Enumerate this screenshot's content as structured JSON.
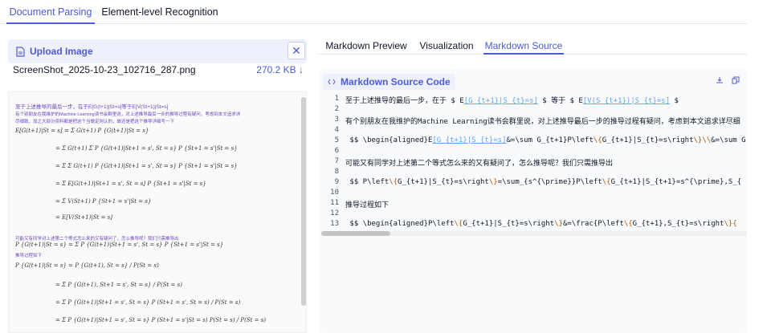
{
  "top_tabs": [
    {
      "label": "Document Parsing",
      "active": true
    },
    {
      "label": "Element-level Recognition",
      "active": false
    }
  ],
  "upload": {
    "label": "Upload Image",
    "icon": "document-icon",
    "file_name": "ScreenShot_2025-10-23_102716_287.png",
    "file_size": "270.2 KB ↓"
  },
  "preview_lines": {
    "l1": "至于上述推导的最后一步，在于E[G(t+1)|St=s]等于E[V(St+1)|St=s]",
    "l2": "有个别朋友在我维护的Machine Learning读书会群里说，对上述推导最后一步的推导过程有疑问，考虑到本文追求详",
    "l3": "尽细致，加之大部分资料都是把这个当做定则认的，故还是把这个推导详细写一下",
    "e1": "E[G(t+1)|St = s] = Σ G(t+1) P {G(t+1)|St = s}",
    "e2": "= Σ G(t+1) Σ P {G(t+1)|St+1 = s', St = s} P {St+1 = s'|St = s}",
    "e3": "= Σ Σ G(t+1) P {G(t+1)|St+1 = s', St = s} P {St+1 = s'|St = s}",
    "e4": "= Σ E[G(t+1)|St+1 = s', St = s] P {St+1 = s'|St = s}",
    "e5": "= Σ V(St+1) P {St+1 = s'|St = s}",
    "e6": "= E[V(St+1)|St = s]",
    "l4": "可能又有同学对上述第二个等式怎么来的又有疑问了，怎么推导呢？我们只需推导出",
    "e7": "P {G(t+1)|St = s} = Σ P {G(t+1)|St+1 = s', St = s} P {St+1 = s'|St = s}",
    "l5": "推导过程如下",
    "e8": "P {G(t+1)|St = s} = P {G(t+1), St = s} / P(St = s)",
    "e9": "= Σ P {G(t+1), St+1 = s', St = s} / P(St = s)",
    "e10": "= Σ P {G(t+1)|St+1 = s', St = s} P (St+1 = s', St = s) / P(St = s)",
    "e11": "= Σ P {G(t+1)|St+1 = s', St = s} P (St+1 = s'|St = s) P(St = s) / P(St = s)"
  },
  "sub_tabs": [
    {
      "label": "Markdown Preview",
      "active": false
    },
    {
      "label": "Visualization",
      "active": false
    },
    {
      "label": "Markdown Source",
      "active": true
    }
  ],
  "code": {
    "title": "Markdown Source Code",
    "line_numbers": [
      "1",
      "2",
      "3",
      "4",
      "5",
      "6",
      "7",
      "8",
      "9",
      "10",
      "11",
      "12",
      "13"
    ],
    "l1_a": "至于上述推导的最后一步，在于 $ E",
    "l1_b": "[G_{t+1}|S_{t}=s]",
    "l1_c": " $ 等于 $ E",
    "l1_d": "[V(S_{t+1})|S_{t}=s]",
    "l1_e": " $",
    "l3": "有个别朋友在我维护的Machine Learning读书会群里说，对上述推导最后一步的推导过程有疑问，考虑到本文追求详尽细",
    "l5_a": " $$ \\begin{aligned}E",
    "l5_b": "[G_{t+1}|S_{t}=s]",
    "l5_c": "&=\\sum G_{t+1}P\\left",
    "l5_d": "\\{",
    "l5_e": "G_{t+1}|S_{t}=s\\right",
    "l5_f": "\\}\\\\",
    "l5_g": "&=\\sum G",
    "l7": "可能又有同学对上述第二个等式怎么来的又有疑问了，怎么推导呢？我们只需推导出",
    "l9_a": " $$ P\\left",
    "l9_b": "\\{",
    "l9_c": "G_{t+1}|S_{t}=s\\right",
    "l9_d": "\\}",
    "l9_e": "=\\sum_{s^{\\prime}}P\\left",
    "l9_f": "\\{",
    "l9_g": "G_{t+1}|S_{t+1}=s^{\\prime},S_{",
    "l11": "推导过程如下",
    "l13_a": " $$ \\begin{aligned}P\\left",
    "l13_b": "\\{",
    "l13_c": "G_{t+1}|S_{t}=s\\right",
    "l13_d": "\\}",
    "l13_e": "&=\\frac{P\\left",
    "l13_f": "\\{",
    "l13_g": "G_{t+1},S_{t}=s\\right",
    "l13_h": "\\}{"
  },
  "colors": {
    "accent": "#4f5bd5",
    "link": "#60a5fa",
    "brace": "#b45309"
  }
}
